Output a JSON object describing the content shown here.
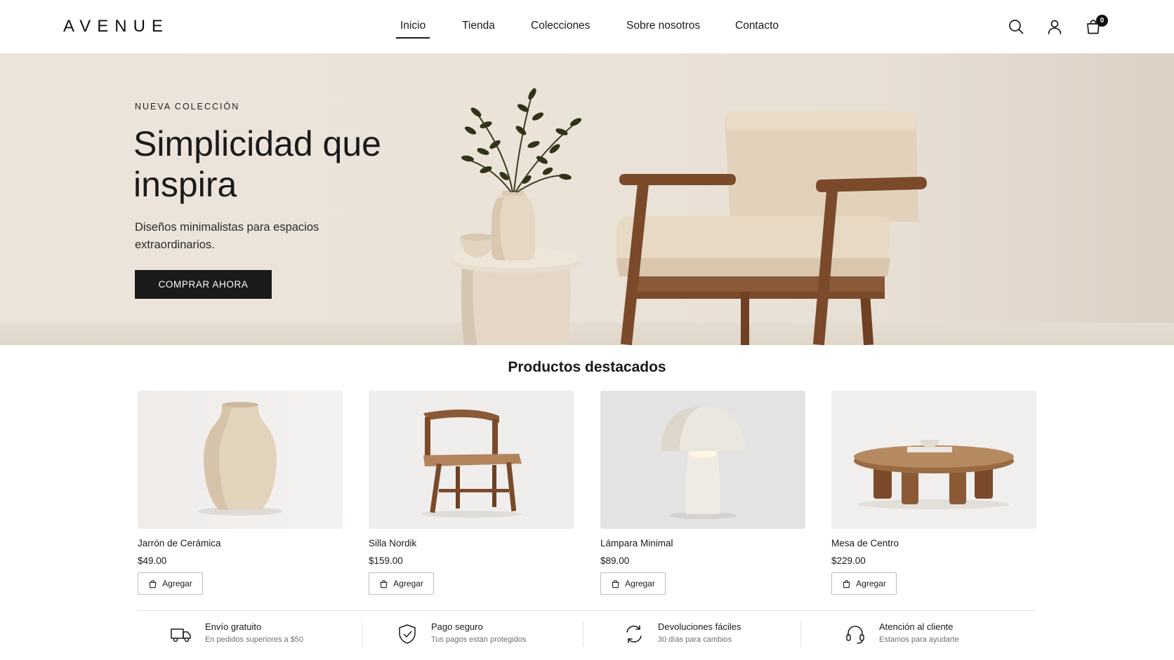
{
  "brand": {
    "logo": "AVENUE"
  },
  "nav": {
    "items": [
      {
        "label": "Inicio",
        "active": true
      },
      {
        "label": "Tienda"
      },
      {
        "label": "Colecciones"
      },
      {
        "label": "Sobre nosotros"
      },
      {
        "label": "Contacto"
      }
    ]
  },
  "header_icons": {
    "search": "search-icon",
    "account": "user-icon",
    "cart": "shopping-bag-icon",
    "cart_count": "0"
  },
  "hero": {
    "eyebrow": "NUEVA COLECCIÓN",
    "title": "Simplicidad que inspira",
    "subtitle": "Diseños minimalistas para espacios extraordinarios.",
    "cta": "COMPRAR AHORA"
  },
  "featured": {
    "title": "Productos destacados",
    "products": [
      {
        "name": "Jarrón de Cerámica",
        "price": "$49.00",
        "button": "Agregar"
      },
      {
        "name": "Silla Nordik",
        "price": "$159.00",
        "button": "Agregar"
      },
      {
        "name": "Lámpara Minimal",
        "price": "$89.00",
        "button": "Agregar"
      },
      {
        "name": "Mesa de Centro",
        "price": "$229.00",
        "button": "Agregar"
      }
    ]
  },
  "features": [
    {
      "icon": "truck-icon",
      "title": "Envío gratuito",
      "subtitle": "En pedidos superiores a $50"
    },
    {
      "icon": "shield-check-icon",
      "title": "Pago seguro",
      "subtitle": "Tus pagos están protegidos"
    },
    {
      "icon": "refresh-icon",
      "title": "Devoluciones fáciles",
      "subtitle": "30 días para cambios"
    },
    {
      "icon": "headset-icon",
      "title": "Atención al cliente",
      "subtitle": "Estamos para ayudarte"
    }
  ],
  "colors": {
    "accent": "#1a1a1a",
    "hero_bg": "#ebe2d8",
    "wood": "#7a4a2b",
    "fabric": "#e4d3bd"
  }
}
